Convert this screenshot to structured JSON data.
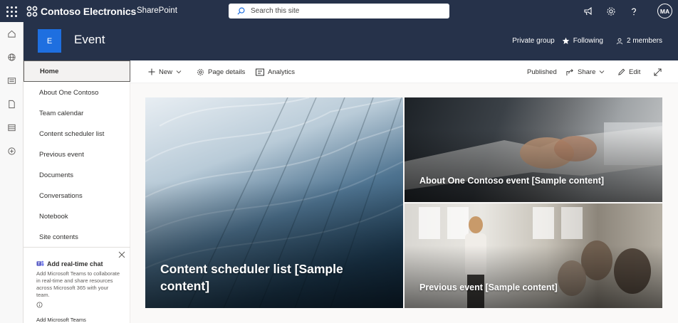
{
  "suite_bar": {
    "brand": "Contoso Electronics",
    "app_name": "SharePoint",
    "search_placeholder": "Search this site",
    "avatar_initials": "MA",
    "icons": [
      "app-launcher-icon",
      "megaphone-icon",
      "gear-icon",
      "help-icon"
    ]
  },
  "app_bar": {
    "icons": [
      "home-icon",
      "globe-icon",
      "news-icon",
      "document-icon",
      "list-icon",
      "add-circle-icon"
    ]
  },
  "site": {
    "logo_letter": "E",
    "title": "Event",
    "privacy": "Private group",
    "following": "Following",
    "members": "2 members",
    "logo_color": "#1e6fe0"
  },
  "nav": {
    "items": [
      {
        "label": "Home",
        "active": true
      },
      {
        "label": "About One Contoso"
      },
      {
        "label": "Team calendar"
      },
      {
        "label": "Content scheduler list"
      },
      {
        "label": "Previous event"
      },
      {
        "label": "Documents"
      },
      {
        "label": "Conversations"
      },
      {
        "label": "Notebook"
      },
      {
        "label": "Site contents"
      }
    ],
    "chat_card": {
      "title": "Add real-time chat",
      "description": "Add Microsoft Teams to collaborate in real-time and share resources across Microsoft 365 with your team.",
      "action": "Add Microsoft Teams"
    }
  },
  "command_bar": {
    "new": "New",
    "page_details": "Page details",
    "analytics": "Analytics",
    "published": "Published",
    "share": "Share",
    "edit": "Edit"
  },
  "hero": {
    "tiles": [
      {
        "caption": "Content scheduler list [Sample content]"
      },
      {
        "caption": "About One Contoso event [Sample content]"
      },
      {
        "caption": "Previous event [Sample content]"
      }
    ]
  },
  "colors": {
    "suite_bar": "#26324a",
    "accent": "#1e6fe0"
  }
}
